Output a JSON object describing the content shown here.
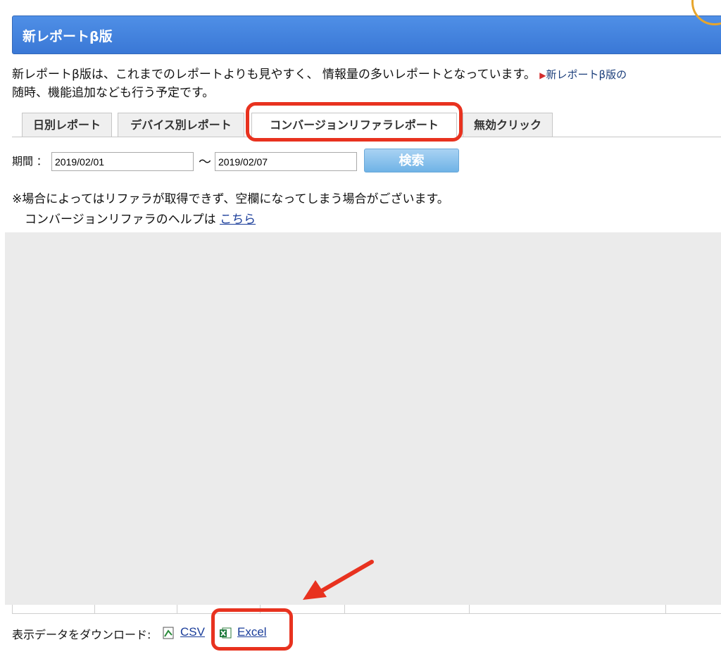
{
  "header": {
    "title": "新レポートβ版"
  },
  "intro": {
    "line1": "新レポートβ版は、これまでのレポートよりも見やすく、 情報量の多いレポートとなっています。",
    "link_text": "新レポートβ版の",
    "line2": "随時、機能追加なども行う予定です。"
  },
  "tabs": [
    {
      "label": "日別レポート"
    },
    {
      "label": "デバイス別レポート"
    },
    {
      "label": "コンバージョンリファラレポート",
      "active": true
    },
    {
      "label": "無効クリック"
    }
  ],
  "search": {
    "period_label": "期間 ：",
    "start_date": "2019/02/01",
    "separator": "〜",
    "end_date": "2019/02/07",
    "button_label": "検索"
  },
  "notes": {
    "warning": "※場合によってはリファラが取得できず、空欄になってしまう場合がございます。",
    "help_prefix": "コンバージョンリファラのヘルプは ",
    "help_link": "こちら"
  },
  "download": {
    "label": "表示データをダウンロード:",
    "csv": "CSV",
    "excel": "Excel"
  },
  "colors": {
    "header": "#3a78d6",
    "highlight": "#e8321f",
    "button": "#6fb3e6",
    "panel": "#ebebeb"
  }
}
